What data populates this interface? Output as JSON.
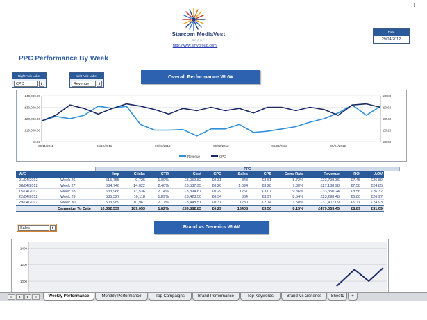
{
  "header": {
    "brand_name": "Starcom MediaVest",
    "brand_sub": "GROUP",
    "url": "http://www.smvgroup.com/",
    "date_label": "Date",
    "date_value": "29/04/2012"
  },
  "page_title": "PPC Performance By Week",
  "controls": {
    "right_axis_label": "Right Axis Label",
    "right_axis_value": "CPC",
    "left_axis_label": "Left Axis Label",
    "left_axis_value": "Revenue",
    "dropdown_arrow": "⬍",
    "overall_button": "Overall Performance WoW",
    "brand_button": "Brand vs Generics WoW",
    "sales_value": "Sales"
  },
  "colors": {
    "revenue": "#2f8fd8",
    "cpc": "#1a2a66",
    "header_blue": "#2b5a9a"
  },
  "chart_data": [
    {
      "type": "line",
      "title": "",
      "x": [
        "06/11/2011",
        "06/12/2011",
        "06/01/2012",
        "06/02/2012",
        "06/03/2012",
        "06/04/2012"
      ],
      "left_axis_ticks": [
        "£40,000.00",
        "£30,000.00",
        "£20,000.00",
        "£10,000.00",
        "£0.00"
      ],
      "right_axis_ticks": [
        "£0.80",
        "£0.60",
        "£0.40",
        "£0.20",
        "£0.00"
      ],
      "ylim_left": [
        0,
        40000
      ],
      "ylim_right": [
        0,
        0.8
      ],
      "grid": true,
      "legend_position": "bottom",
      "series": [
        {
          "name": "Revenue",
          "axis": "left",
          "values": [
            18000,
            22000,
            20000,
            23000,
            31000,
            29000,
            31000,
            15000,
            10000,
            10000,
            10500,
            5000,
            11000,
            11000,
            15000,
            8000,
            9000,
            11000,
            13000,
            17000,
            20000,
            25000,
            32000,
            23000,
            31000
          ]
        },
        {
          "name": "CPC",
          "axis": "right",
          "values": [
            0.36,
            0.46,
            0.64,
            0.58,
            0.48,
            0.58,
            0.66,
            0.62,
            0.56,
            0.48,
            0.58,
            0.54,
            0.6,
            0.54,
            0.58,
            0.5,
            0.6,
            0.6,
            0.54,
            0.6,
            0.56,
            0.46,
            0.64,
            0.66,
            0.6
          ]
        }
      ]
    },
    {
      "type": "line",
      "title": "",
      "y_ticks": [
        "1400",
        "1200",
        "1000"
      ],
      "ylim": [
        950,
        1420
      ],
      "grid": true,
      "series": [
        {
          "name": "",
          "points": [
            [
              0.86,
              940
            ],
            [
              0.91,
              1140
            ],
            [
              0.95,
              1000
            ],
            [
              0.99,
              1160
            ]
          ]
        }
      ]
    }
  ],
  "table": {
    "group_label": "PPC",
    "headers": [
      "W/E",
      "",
      "Imp",
      "Clicks",
      "CTR",
      "Cost",
      "CPC",
      "Sales",
      "CPS",
      "Conv Rate",
      "Revenue",
      "ROI",
      "AOV"
    ],
    "rows": [
      [
        "01/04/2012",
        "Week 26",
        "515,755",
        "9,725",
        "1.89%",
        "£3,059.82",
        "£0.31",
        "848",
        "£3.61",
        "8.72%",
        "£22,799.36",
        "£7.45",
        "£26.89"
      ],
      [
        "08/04/2012",
        "Week 27",
        "584,746",
        "14,022",
        "2.40%",
        "£3,587.95",
        "£0.26",
        "1,094",
        "£3.28",
        "7.80%",
        "£27,188.98",
        "£7.58",
        "£24.85"
      ],
      [
        "15/04/2012",
        "Week 28",
        "633,968",
        "13,536",
        "2.14%",
        "£3,894.67",
        "£0.29",
        "1267",
        "£3.07",
        "9.36%",
        "£33,350.24",
        "£8.56",
        "£26.32"
      ],
      [
        "22/04/2012",
        "Week 29",
        "535,327",
        "10,118",
        "1.89%",
        "£3,428.50",
        "£0.34",
        "864",
        "£3.97",
        "8.54%",
        "£23,298.48",
        "£6.80",
        "£26.97"
      ],
      [
        "29/04/2012",
        "Week 30",
        "503,989",
        "10,961",
        "2.17%",
        "£3,448.51",
        "£0.31",
        "1280",
        "£2.74",
        "11.50%",
        "£31,407.09",
        "£9.11",
        "£24.93"
      ]
    ],
    "total": [
      "Campaign To Date",
      "10,362,539",
      "189,053",
      "1.82%",
      "£53,882.83",
      "£0.29",
      "15408",
      "£3.50",
      "8.15%",
      "£479,053.45",
      "£8.89",
      "£31.09"
    ]
  },
  "tabs": {
    "nav": [
      "|◂",
      "◂",
      "▸",
      "▸|"
    ],
    "items": [
      "Weekly Performance",
      "Monthly Performance",
      "Top Campaigns",
      "Brand Performance",
      "Top Keywords",
      "Brand Vs Generics",
      "Sheet1",
      "+"
    ]
  }
}
